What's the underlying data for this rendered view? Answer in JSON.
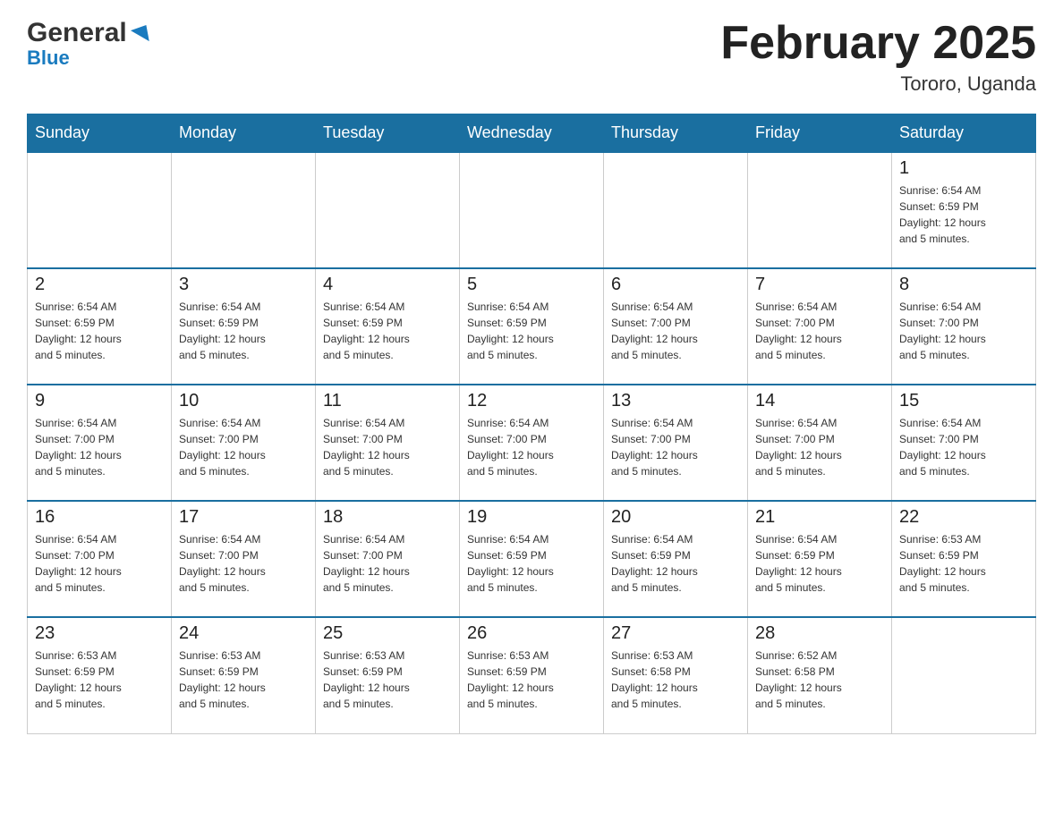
{
  "header": {
    "logo_line1": "General",
    "logo_line2": "Blue",
    "month_title": "February 2025",
    "location": "Tororo, Uganda"
  },
  "weekdays": [
    "Sunday",
    "Monday",
    "Tuesday",
    "Wednesday",
    "Thursday",
    "Friday",
    "Saturday"
  ],
  "weeks": [
    [
      {
        "day": "",
        "info": ""
      },
      {
        "day": "",
        "info": ""
      },
      {
        "day": "",
        "info": ""
      },
      {
        "day": "",
        "info": ""
      },
      {
        "day": "",
        "info": ""
      },
      {
        "day": "",
        "info": ""
      },
      {
        "day": "1",
        "info": "Sunrise: 6:54 AM\nSunset: 6:59 PM\nDaylight: 12 hours\nand 5 minutes."
      }
    ],
    [
      {
        "day": "2",
        "info": "Sunrise: 6:54 AM\nSunset: 6:59 PM\nDaylight: 12 hours\nand 5 minutes."
      },
      {
        "day": "3",
        "info": "Sunrise: 6:54 AM\nSunset: 6:59 PM\nDaylight: 12 hours\nand 5 minutes."
      },
      {
        "day": "4",
        "info": "Sunrise: 6:54 AM\nSunset: 6:59 PM\nDaylight: 12 hours\nand 5 minutes."
      },
      {
        "day": "5",
        "info": "Sunrise: 6:54 AM\nSunset: 6:59 PM\nDaylight: 12 hours\nand 5 minutes."
      },
      {
        "day": "6",
        "info": "Sunrise: 6:54 AM\nSunset: 7:00 PM\nDaylight: 12 hours\nand 5 minutes."
      },
      {
        "day": "7",
        "info": "Sunrise: 6:54 AM\nSunset: 7:00 PM\nDaylight: 12 hours\nand 5 minutes."
      },
      {
        "day": "8",
        "info": "Sunrise: 6:54 AM\nSunset: 7:00 PM\nDaylight: 12 hours\nand 5 minutes."
      }
    ],
    [
      {
        "day": "9",
        "info": "Sunrise: 6:54 AM\nSunset: 7:00 PM\nDaylight: 12 hours\nand 5 minutes."
      },
      {
        "day": "10",
        "info": "Sunrise: 6:54 AM\nSunset: 7:00 PM\nDaylight: 12 hours\nand 5 minutes."
      },
      {
        "day": "11",
        "info": "Sunrise: 6:54 AM\nSunset: 7:00 PM\nDaylight: 12 hours\nand 5 minutes."
      },
      {
        "day": "12",
        "info": "Sunrise: 6:54 AM\nSunset: 7:00 PM\nDaylight: 12 hours\nand 5 minutes."
      },
      {
        "day": "13",
        "info": "Sunrise: 6:54 AM\nSunset: 7:00 PM\nDaylight: 12 hours\nand 5 minutes."
      },
      {
        "day": "14",
        "info": "Sunrise: 6:54 AM\nSunset: 7:00 PM\nDaylight: 12 hours\nand 5 minutes."
      },
      {
        "day": "15",
        "info": "Sunrise: 6:54 AM\nSunset: 7:00 PM\nDaylight: 12 hours\nand 5 minutes."
      }
    ],
    [
      {
        "day": "16",
        "info": "Sunrise: 6:54 AM\nSunset: 7:00 PM\nDaylight: 12 hours\nand 5 minutes."
      },
      {
        "day": "17",
        "info": "Sunrise: 6:54 AM\nSunset: 7:00 PM\nDaylight: 12 hours\nand 5 minutes."
      },
      {
        "day": "18",
        "info": "Sunrise: 6:54 AM\nSunset: 7:00 PM\nDaylight: 12 hours\nand 5 minutes."
      },
      {
        "day": "19",
        "info": "Sunrise: 6:54 AM\nSunset: 6:59 PM\nDaylight: 12 hours\nand 5 minutes."
      },
      {
        "day": "20",
        "info": "Sunrise: 6:54 AM\nSunset: 6:59 PM\nDaylight: 12 hours\nand 5 minutes."
      },
      {
        "day": "21",
        "info": "Sunrise: 6:54 AM\nSunset: 6:59 PM\nDaylight: 12 hours\nand 5 minutes."
      },
      {
        "day": "22",
        "info": "Sunrise: 6:53 AM\nSunset: 6:59 PM\nDaylight: 12 hours\nand 5 minutes."
      }
    ],
    [
      {
        "day": "23",
        "info": "Sunrise: 6:53 AM\nSunset: 6:59 PM\nDaylight: 12 hours\nand 5 minutes."
      },
      {
        "day": "24",
        "info": "Sunrise: 6:53 AM\nSunset: 6:59 PM\nDaylight: 12 hours\nand 5 minutes."
      },
      {
        "day": "25",
        "info": "Sunrise: 6:53 AM\nSunset: 6:59 PM\nDaylight: 12 hours\nand 5 minutes."
      },
      {
        "day": "26",
        "info": "Sunrise: 6:53 AM\nSunset: 6:59 PM\nDaylight: 12 hours\nand 5 minutes."
      },
      {
        "day": "27",
        "info": "Sunrise: 6:53 AM\nSunset: 6:58 PM\nDaylight: 12 hours\nand 5 minutes."
      },
      {
        "day": "28",
        "info": "Sunrise: 6:52 AM\nSunset: 6:58 PM\nDaylight: 12 hours\nand 5 minutes."
      },
      {
        "day": "",
        "info": ""
      }
    ]
  ],
  "accent_color": "#1a6fa0"
}
